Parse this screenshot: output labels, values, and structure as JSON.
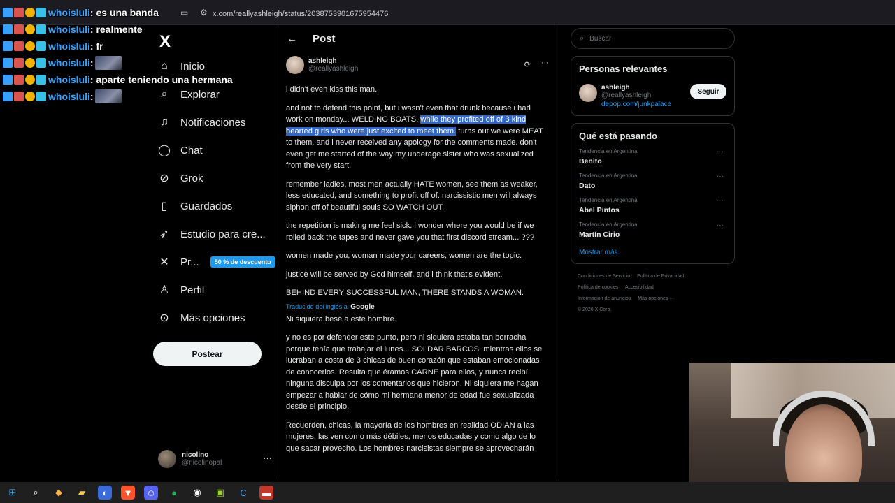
{
  "browser": {
    "url": "x.com/reallyashleigh/status/2038753901675954476"
  },
  "chat": [
    {
      "user": "whoisluli",
      "message": ": es una banda",
      "emote": false
    },
    {
      "user": "whoisluli",
      "message": ": realmente",
      "emote": false
    },
    {
      "user": "whoisluli",
      "message": ": fr",
      "emote": false
    },
    {
      "user": "whoisluli",
      "message": ":",
      "emote": true
    },
    {
      "user": "whoisluli",
      "message": ": aparte teniendo una hermana",
      "emote": false
    },
    {
      "user": "whoisluli",
      "message": ":",
      "emote": true
    }
  ],
  "nav": {
    "logo": "X",
    "items": [
      {
        "label": "Inicio",
        "icon": "home-icon"
      },
      {
        "label": "Explorar",
        "icon": "search-icon"
      },
      {
        "label": "Notificaciones",
        "icon": "bell-icon"
      },
      {
        "label": "Chat",
        "icon": "chat-icon"
      },
      {
        "label": "Grok",
        "icon": "grok-icon"
      },
      {
        "label": "Guardados",
        "icon": "bookmark-icon"
      },
      {
        "label": "Estudio para cre...",
        "icon": "rocket-icon"
      },
      {
        "label": "Pr...",
        "icon": "x-premium-icon"
      },
      {
        "label": "Perfil",
        "icon": "person-icon"
      },
      {
        "label": "Más opciones",
        "icon": "more-circle-icon"
      }
    ],
    "promo_badge": "50 % de descuento",
    "post_button": "Postear",
    "account": {
      "name": "nicolino",
      "handle": "@nicolinopal"
    }
  },
  "main": {
    "title": "Post",
    "author": {
      "name": "ashleigh",
      "handle": "@reallyashleigh"
    },
    "paragraphs": {
      "p1": "i didn't even kiss this man.",
      "p2_before": "and not to defend this point, but i wasn't even that drunk because i had work on monday... WELDING BOATS. ",
      "p2_highlight": "while they profited off of 3 kind hearted girls who were just excited to meet them.",
      "p2_after": " turns out we were MEAT to them, and i never received any apology for the comments made. don't even get me started of the way my underage sister who was sexualized from the very start.",
      "p3": "remember ladies, most men actually HATE women, see them as weaker, less educated, and something to profit off of. narcissistic men will always siphon off of beautiful souls SO WATCH OUT.",
      "p4": "the repetition is making me feel sick. i wonder where you would be if we rolled back the tapes and never gave you that first discord stream... ???",
      "p5": "women made you, woman made your careers, women are the topic.",
      "p6": "justice will be served by God himself. and i think that's evident.",
      "p7": "BEHIND EVERY SUCCESSFUL MAN, THERE STANDS A WOMAN."
    },
    "translated_label": "Traducido del inglés al",
    "translated_by": "Google",
    "translation": {
      "t1": "Ni siquiera besé a este hombre.",
      "t2": "y no es por defender este punto, pero ni siquiera estaba tan borracha porque tenía que trabajar el lunes... SOLDAR BARCOS. mientras ellos se lucraban a costa de 3 chicas de buen corazón que estaban emocionadas de conocerlos. Resulta que éramos CARNE para ellos, y nunca recibí ninguna disculpa por los comentarios que hicieron. Ni siquiera me hagan empezar a hablar de cómo mi hermana menor de edad fue sexualizada desde el principio.",
      "t3": "Recuerden, chicas, la mayoría de los hombres en realidad ODIAN a las mujeres, las ven como más débiles, menos educadas y como algo de lo que sacar provecho. Los hombres narcisistas siempre se aprovecharán"
    }
  },
  "right": {
    "search_placeholder": "Buscar",
    "relevant_title": "Personas relevantes",
    "relevant": {
      "name": "ashleigh",
      "handle": "@reallyashleigh",
      "link": "depop.com/junkpalace",
      "follow": "Seguir"
    },
    "trending_title": "Qué está pasando",
    "trends": [
      {
        "context": "Tendencia en Argentina",
        "name": "Benito"
      },
      {
        "context": "Tendencia en Argentina",
        "name": "Dato"
      },
      {
        "context": "Tendencia en Argentina",
        "name": "Abel Pintos"
      },
      {
        "context": "Tendencia en Argentina",
        "name": "Martín Cirio"
      }
    ],
    "show_more": "Mostrar más",
    "footer": {
      "terms": "Condiciones de Servicio",
      "privacy": "Política de Privacidad",
      "cookies": "Política de cookies",
      "accessibility": "Accesibilidad",
      "ads": "Información de anuncios",
      "more": "Más opciones ···",
      "copyright": "© 2026 X Corp."
    }
  }
}
